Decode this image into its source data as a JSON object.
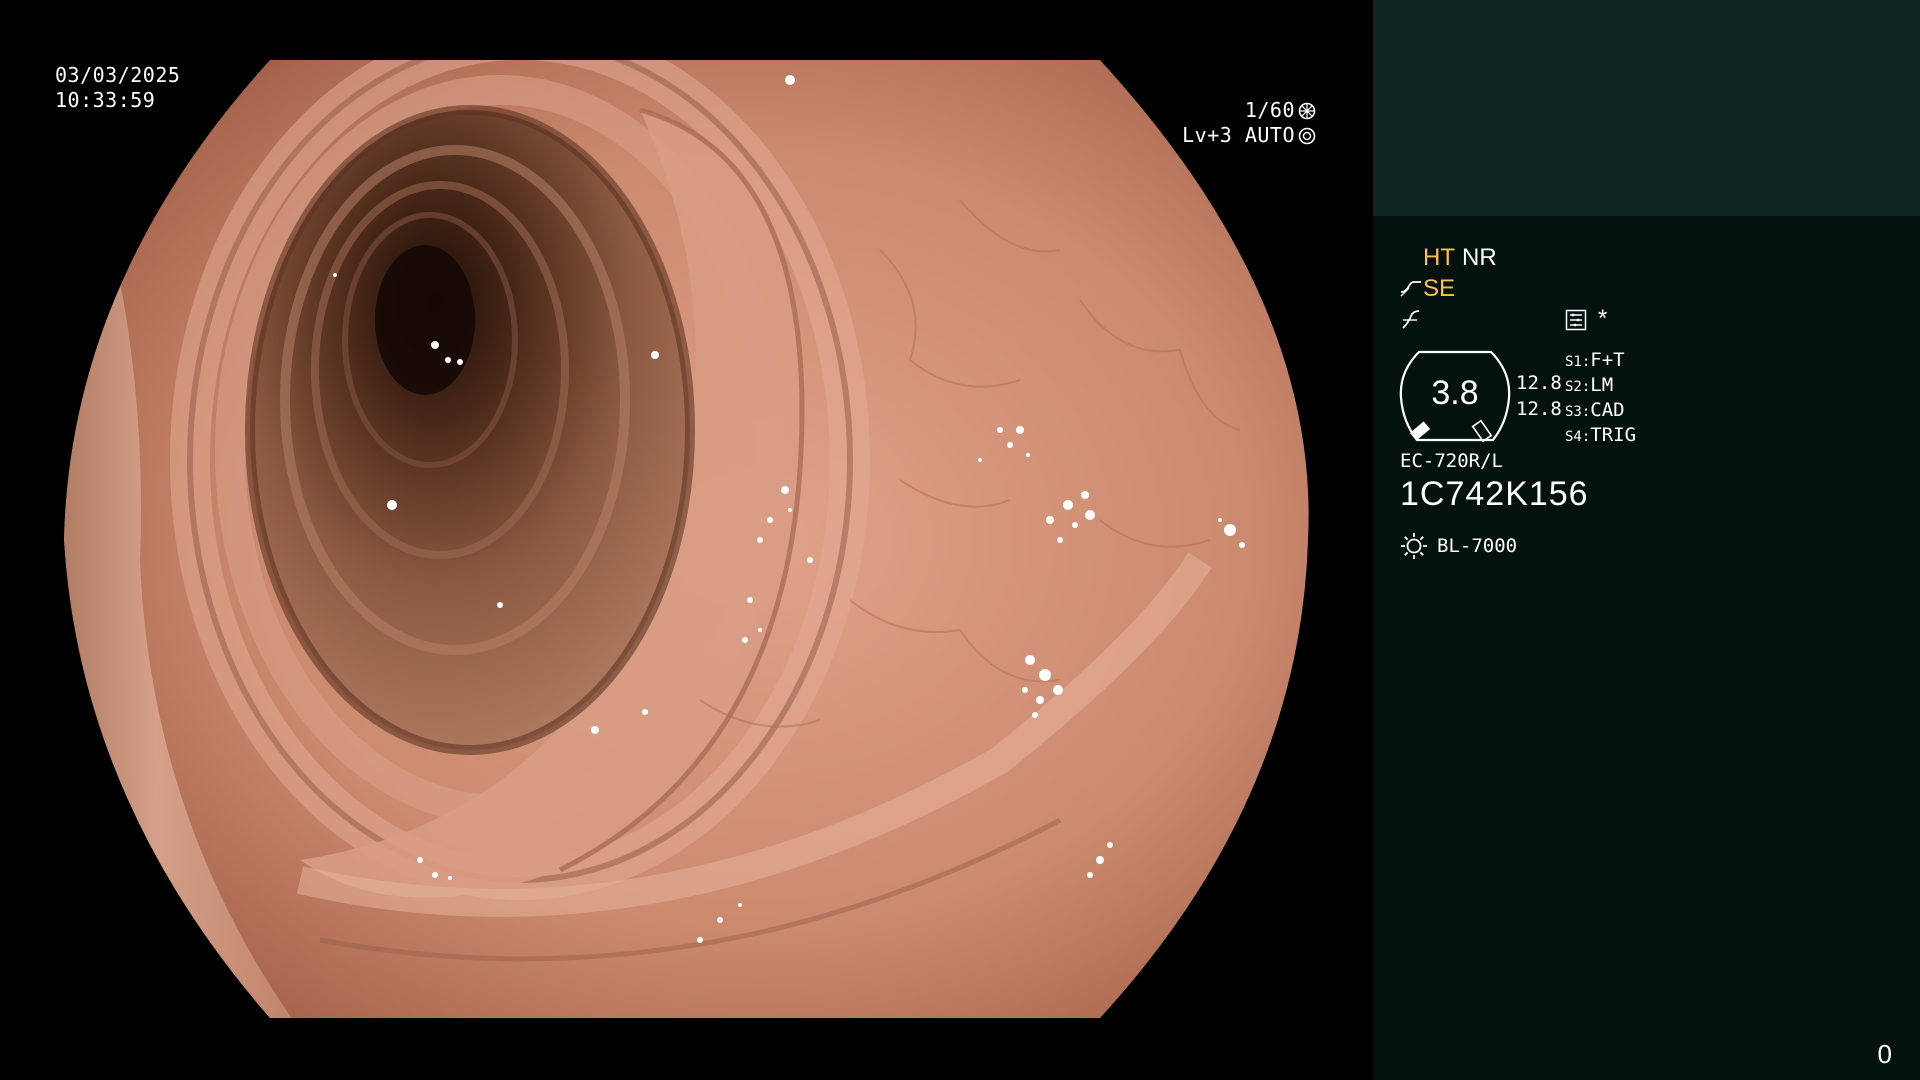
{
  "overlay": {
    "date": "03/03/2025",
    "time": "10:33:59",
    "shutter": "1/60",
    "shutter_icon": "aperture-icon",
    "level": "Lv+3",
    "mode": "AUTO",
    "mode_icon": "iris-auto-icon"
  },
  "panel": {
    "ht": "HT",
    "nr": "NR",
    "se": "SE",
    "se_icon": "enhancement-curve-icon",
    "gamma_icon": "gamma-curve-icon",
    "memo_icon": "menu-list-icon",
    "asterisk": "*",
    "gauge": {
      "value": "3.8",
      "icon": "zoom-gauge-icon"
    },
    "side_values": [
      "12.8",
      "12.8"
    ],
    "scope_buttons": [
      {
        "key": "S1:",
        "label": "F+T"
      },
      {
        "key": "S2:",
        "label": "LM"
      },
      {
        "key": "S3:",
        "label": "CAD"
      },
      {
        "key": "S4:",
        "label": "TRIG"
      }
    ],
    "scope_model": "EC-720R/L",
    "scope_serial": "1C742K156",
    "light_icon": "light-source-icon",
    "light_source": "BL-7000",
    "page_counter": "0"
  },
  "colors": {
    "panel_top": "#0e2522",
    "panel_bg": "#04120f",
    "highlight_text": "#ffc04a",
    "tissue": "#c9876b"
  }
}
